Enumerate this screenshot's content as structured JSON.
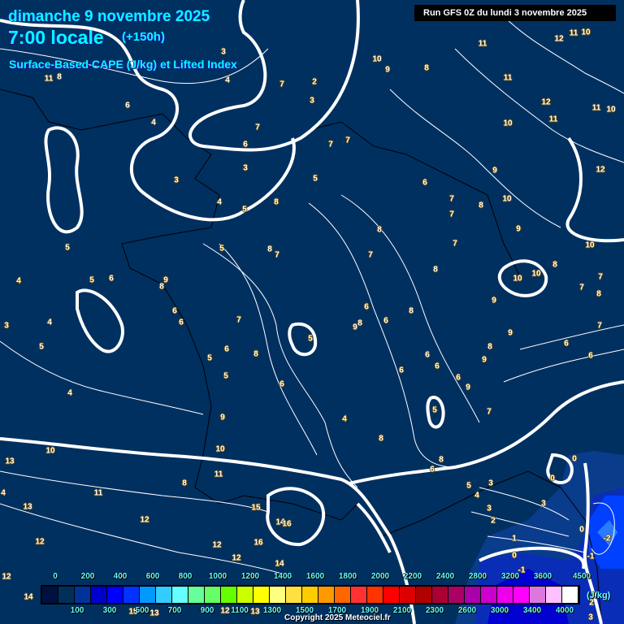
{
  "header": {
    "date": "dimanche 9 novembre 2025",
    "time": "7:00 locale",
    "lead": "(+150h)",
    "parameter": "Surface-Based CAPE (J/kg) et Lifted Index",
    "run": "Run GFS 0Z du lundi 3 novembre 2025"
  },
  "colors": {
    "background": "#003060",
    "contour": "#ffffff",
    "lifted_index_label": "#ffffff"
  },
  "legend": {
    "unit": "(J/kg)",
    "swatches": [
      "#001040",
      "#00305a",
      "#003399",
      "#0000cc",
      "#0000ff",
      "#0033ff",
      "#0099ff",
      "#33ccff",
      "#66ffff",
      "#66ff99",
      "#66ff66",
      "#66ff00",
      "#ccff00",
      "#ffff00",
      "#ffff80",
      "#ffe040",
      "#ffcc00",
      "#ff9900",
      "#ff6600",
      "#ff3333",
      "#ff3300",
      "#ff0000",
      "#dd0000",
      "#b00000",
      "#aa0033",
      "#aa0066",
      "#aa00aa",
      "#cc00cc",
      "#ee00ee",
      "#ff00ff",
      "#dd77dd",
      "#ffc0ff",
      "#ffffff"
    ],
    "top_labels": [
      "0",
      "200",
      "400",
      "600",
      "800",
      "1000",
      "1200",
      "1400",
      "1600",
      "1800",
      "2000",
      "2200",
      "2400",
      "2800",
      "3200",
      "3600",
      "4500"
    ],
    "bottom_labels": [
      "100",
      "300",
      "500",
      "700",
      "900",
      "1100",
      "1300",
      "1500",
      "1700",
      "1900",
      "2100",
      "2300",
      "2600",
      "3000",
      "3400",
      "4000"
    ]
  },
  "lifted_index_labels": [
    "8",
    "11",
    "6",
    "4",
    "4",
    "3",
    "7",
    "2",
    "3",
    "7",
    "6",
    "3",
    "3",
    "4",
    "5",
    "8",
    "5",
    "7",
    "7",
    "10",
    "9",
    "8",
    "11",
    "11",
    "12",
    "11",
    "10",
    "12",
    "11",
    "11",
    "10",
    "10",
    "9",
    "12",
    "10",
    "8",
    "7",
    "7",
    "6",
    "9",
    "10",
    "8",
    "10",
    "10",
    "7",
    "7",
    "8",
    "9",
    "9",
    "7",
    "6",
    "6",
    "8",
    "9",
    "6",
    "6",
    "6",
    "6",
    "9",
    "5",
    "7",
    "8",
    "7",
    "8",
    "7",
    "8",
    "7",
    "5",
    "5",
    "4",
    "5",
    "6",
    "9",
    "8",
    "6",
    "6",
    "7",
    "6",
    "8",
    "9",
    "6",
    "8",
    "5",
    "6",
    "8",
    "5",
    "5",
    "6",
    "4",
    "4",
    "3",
    "5",
    "4",
    "8",
    "9",
    "10",
    "10",
    "13",
    "8",
    "6",
    "5",
    "4",
    "3",
    "3",
    "2",
    "11",
    "8",
    "11",
    "4",
    "13",
    "15",
    "14",
    "16",
    "12",
    "16",
    "12",
    "12",
    "14",
    "12",
    "12",
    "14",
    "13",
    "12",
    "13",
    "15",
    "0",
    "0",
    "3",
    "1",
    "0",
    "-1",
    "0",
    "-2",
    "-1",
    "1",
    "2",
    "3"
  ],
  "copyright": "Copyright 2025 Meteociel.fr"
}
